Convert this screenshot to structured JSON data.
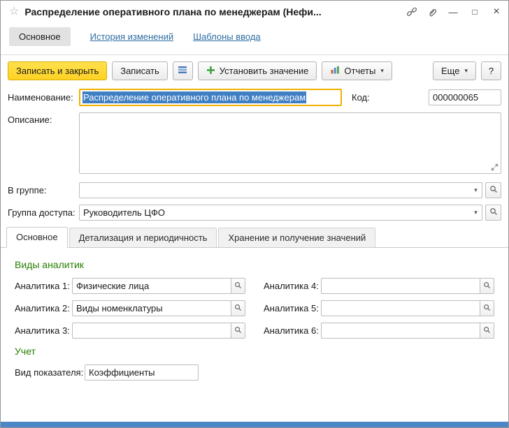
{
  "window": {
    "title": "Распределение оперативного плана по менеджерам (Нефи..."
  },
  "icons": {
    "star": "☆",
    "caret_down": "▾",
    "minimize": "—",
    "maximize": "□",
    "close": "×"
  },
  "nav": {
    "tabs": [
      {
        "label": "Основное"
      },
      {
        "label": "История изменений"
      },
      {
        "label": "Шаблоны ввода"
      }
    ]
  },
  "toolbar": {
    "save_close": "Записать и закрыть",
    "save": "Записать",
    "set_value": "Установить значение",
    "reports": "Отчеты",
    "more": "Еще",
    "help": "?"
  },
  "form": {
    "name": {
      "label": "Наименование:",
      "value": "Распределение оперативного плана по менеджерам"
    },
    "code": {
      "label": "Код:",
      "value": "000000065"
    },
    "description": {
      "label": "Описание:",
      "value": ""
    },
    "group": {
      "label": "В группе:",
      "value": ""
    },
    "access_group": {
      "label": "Группа доступа:",
      "value": "Руководитель ЦФО"
    }
  },
  "detail_tabs": [
    {
      "label": "Основное"
    },
    {
      "label": "Детализация и периодичность"
    },
    {
      "label": "Хранение и получение значений"
    }
  ],
  "analytics": {
    "title": "Виды аналитик",
    "fields": [
      {
        "label": "Аналитика 1:",
        "value": "Физические лица"
      },
      {
        "label": "Аналитика 2:",
        "value": "Виды номенклатуры"
      },
      {
        "label": "Аналитика 3:",
        "value": ""
      },
      {
        "label": "Аналитика 4:",
        "value": ""
      },
      {
        "label": "Аналитика 5:",
        "value": ""
      },
      {
        "label": "Аналитика 6:",
        "value": ""
      }
    ]
  },
  "accounting": {
    "title": "Учет",
    "indicator": {
      "label": "Вид показателя:",
      "value": "Коэффициенты"
    }
  },
  "colors": {
    "accent_yellow": "#ffd224",
    "link_blue": "#2d6da3",
    "section_green": "#267f00",
    "focus_orange": "#f0b000",
    "selection_blue": "#3f7fc4",
    "strip_blue": "#4b86c6"
  }
}
